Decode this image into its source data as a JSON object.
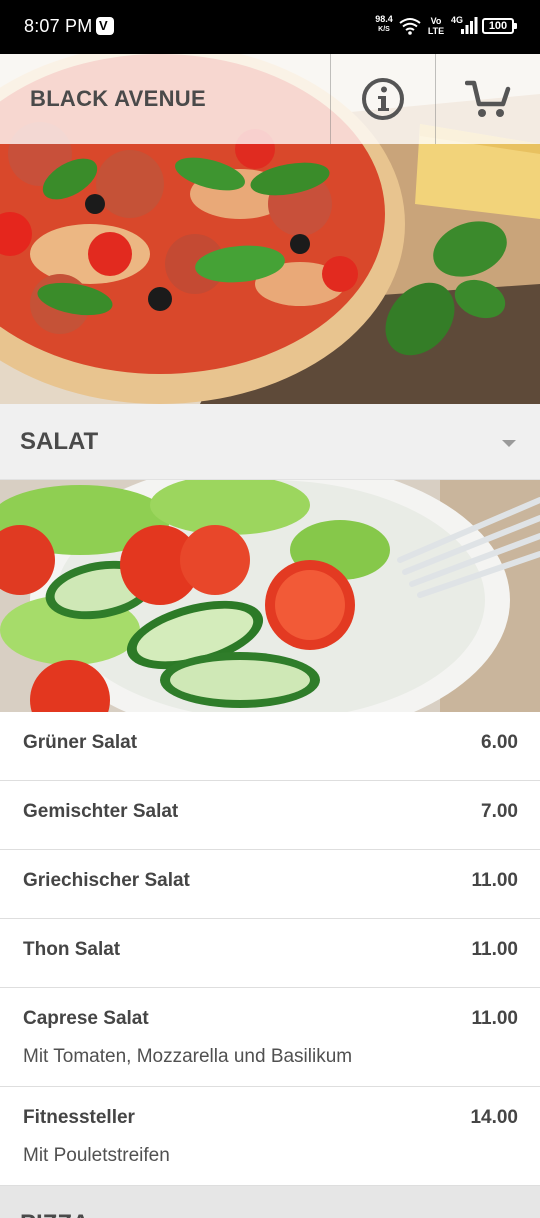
{
  "status_bar": {
    "time": "8:07 PM",
    "speed_value": "98.4",
    "speed_unit": "K/S",
    "volte_top": "Vo",
    "volte_bottom": "LTE",
    "network": "4G",
    "battery": "100"
  },
  "header": {
    "title": "BLACK AVENUE",
    "info_icon": "info-icon",
    "cart_icon": "cart-icon"
  },
  "category": {
    "label": "SALAT",
    "icon": "chevron-down-icon"
  },
  "menu_items": [
    {
      "name": "Grüner Salat",
      "price": "6.00",
      "description": ""
    },
    {
      "name": "Gemischter Salat",
      "price": "7.00",
      "description": ""
    },
    {
      "name": "Griechischer Salat",
      "price": "11.00",
      "description": ""
    },
    {
      "name": "Thon Salat",
      "price": "11.00",
      "description": ""
    },
    {
      "name": "Caprese Salat",
      "price": "11.00",
      "description": "Mit Tomaten, Mozzarella und Basilikum"
    },
    {
      "name": "Fitnessteller",
      "price": "14.00",
      "description": "Mit Pouletstreifen"
    }
  ],
  "next_category": {
    "label": "PIZZA"
  }
}
